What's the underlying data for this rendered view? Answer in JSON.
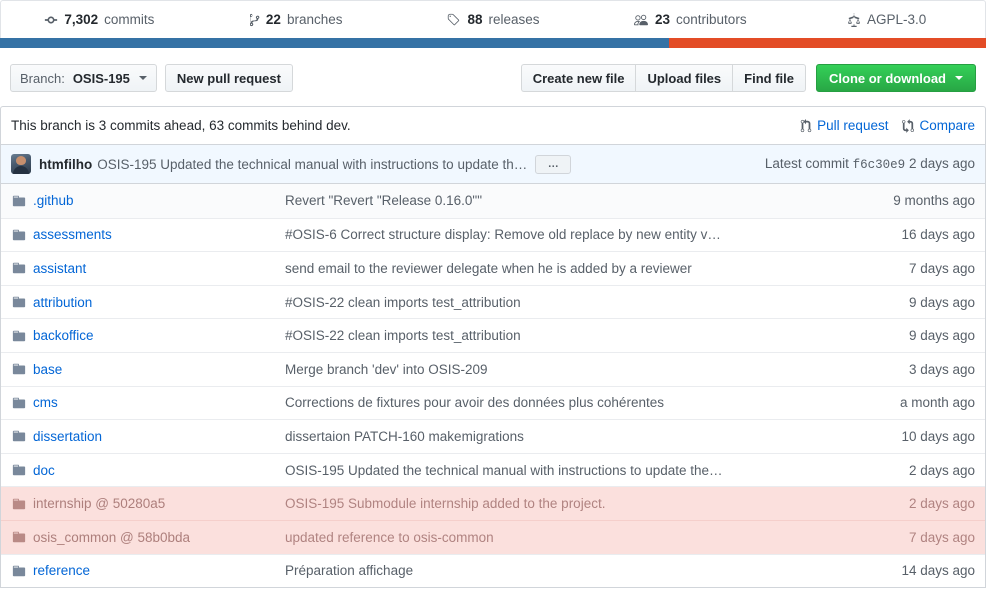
{
  "stats": [
    {
      "icon": "git-commit-icon",
      "number": "7,302",
      "label": "commits"
    },
    {
      "icon": "branch-icon",
      "number": "22",
      "label": "branches"
    },
    {
      "icon": "tag-icon",
      "number": "88",
      "label": "releases"
    },
    {
      "icon": "people-icon",
      "number": "23",
      "label": "contributors"
    },
    {
      "icon": "law-icon",
      "number": "",
      "label": "AGPL-3.0"
    }
  ],
  "languages": [
    {
      "name": "primary",
      "color": "#3572a5",
      "percent": 67.8
    },
    {
      "name": "secondary",
      "color": "#e34c26",
      "percent": 32.2
    }
  ],
  "toolbar": {
    "branch_prefix": "Branch:",
    "branch_name": "OSIS-195",
    "new_pull_request": "New pull request",
    "create_new_file": "Create new file",
    "upload_files": "Upload files",
    "find_file": "Find file",
    "clone_or_download": "Clone or download"
  },
  "branch_notice": {
    "text": "This branch is 3 commits ahead, 63 commits behind dev.",
    "pull_request": "Pull request",
    "compare": "Compare"
  },
  "latest_commit": {
    "author": "htmfilho",
    "message": "OSIS-195 Updated the technical manual with instructions to update the…",
    "expand_label": "…",
    "meta_prefix": "Latest commit",
    "sha": "f6c30e9",
    "age": "2 days ago"
  },
  "files": [
    {
      "icon": "folder-icon",
      "type": "dir",
      "name": ".github",
      "message": "Revert \"Revert \"Release 0.16.0\"\"",
      "age": "9 months ago"
    },
    {
      "icon": "folder-icon",
      "type": "dir",
      "name": "assessments",
      "message": "#OSIS-6 Correct structure display: Remove old replace by new entity v…",
      "age": "16 days ago"
    },
    {
      "icon": "folder-icon",
      "type": "dir",
      "name": "assistant",
      "message": "send email to the reviewer delegate when he is added by a reviewer",
      "age": "7 days ago"
    },
    {
      "icon": "folder-icon",
      "type": "dir",
      "name": "attribution",
      "message": "#OSIS-22 clean imports test_attribution",
      "age": "9 days ago"
    },
    {
      "icon": "folder-icon",
      "type": "dir",
      "name": "backoffice",
      "message": "#OSIS-22 clean imports test_attribution",
      "age": "9 days ago"
    },
    {
      "icon": "folder-icon",
      "type": "dir",
      "name": "base",
      "message": "Merge branch 'dev' into OSIS-209",
      "age": "3 days ago"
    },
    {
      "icon": "folder-icon",
      "type": "dir",
      "name": "cms",
      "message": "Corrections de fixtures pour avoir des données plus cohérentes",
      "age": "a month ago"
    },
    {
      "icon": "folder-icon",
      "type": "dir",
      "name": "dissertation",
      "message": "dissertaion PATCH-160 makemigrations",
      "age": "10 days ago"
    },
    {
      "icon": "folder-icon",
      "type": "dir",
      "name": "doc",
      "message": "OSIS-195 Updated the technical manual with instructions to update the…",
      "age": "2 days ago"
    },
    {
      "icon": "submodule-icon",
      "type": "submodule",
      "name": "internship @ 50280a5",
      "message": "OSIS-195 Submodule internship added to the project.",
      "age": "2 days ago"
    },
    {
      "icon": "submodule-icon",
      "type": "submodule",
      "name": "osis_common @ 58b0bda",
      "message": "updated reference to osis-common",
      "age": "7 days ago"
    },
    {
      "icon": "folder-icon",
      "type": "dir",
      "name": "reference",
      "message": "Préparation affichage",
      "age": "14 days ago"
    }
  ],
  "colors": {
    "link": "#0366d6",
    "green_button": "#2cbe4e",
    "submodule_row": "#fbe0dd",
    "commit_header": "#f1f8ff",
    "border": "#d1d5da"
  }
}
